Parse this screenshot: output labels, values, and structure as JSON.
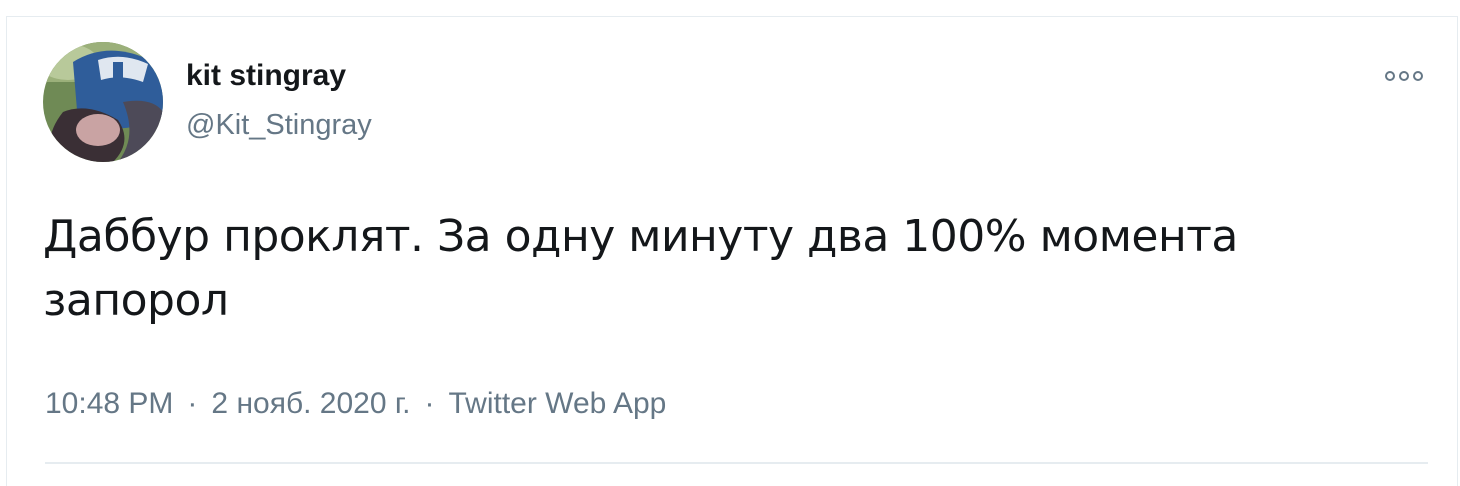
{
  "author": {
    "display_name": "kit stingray",
    "handle": "@Kit_Stingray",
    "avatar_icon": "profile-photo-avatar"
  },
  "more_icon": "more-options-icon",
  "tweet": {
    "text": "Даббур проклят. За одну минуту два 100% момента запорол",
    "time": "10:48 PM",
    "date": "2 нояб. 2020 г.",
    "source": "Twitter Web App",
    "separator": "·"
  },
  "colors": {
    "text_primary": "#14171a",
    "text_secondary": "#657786",
    "border": "#e6ecf0"
  }
}
